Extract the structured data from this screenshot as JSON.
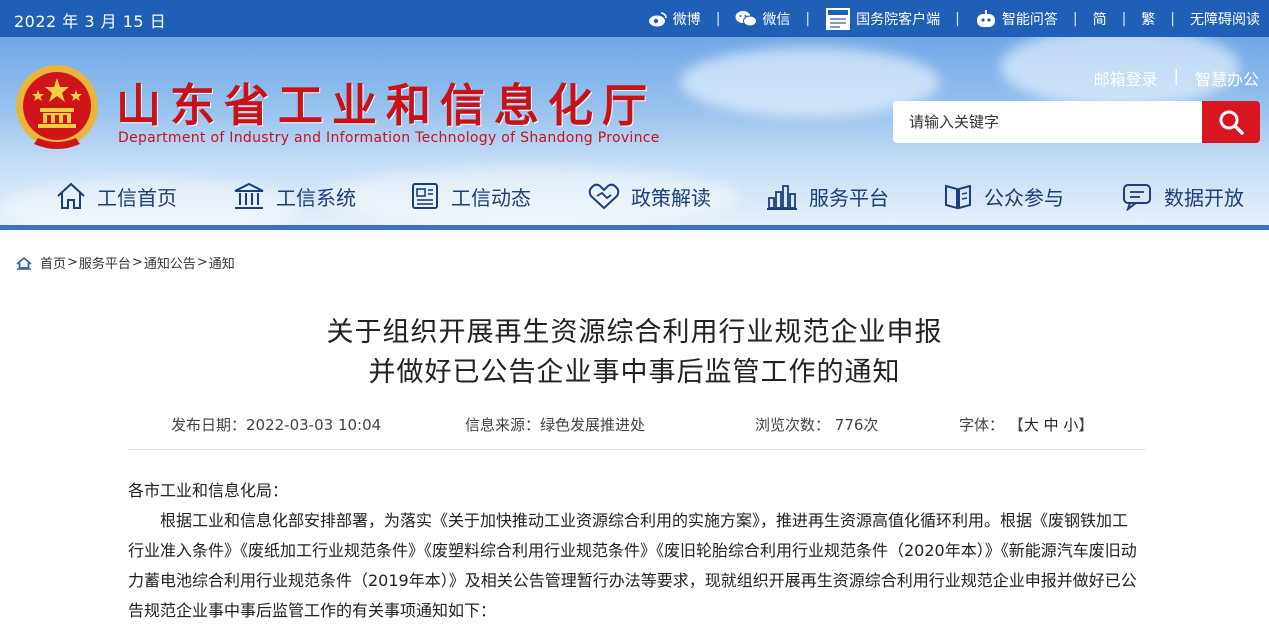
{
  "topbar": {
    "date": "2022 年 3 月 15 日",
    "links": [
      {
        "label": "微博",
        "icon": "weibo-icon"
      },
      {
        "label": "微信",
        "icon": "wechat-icon"
      },
      {
        "label": "国务院客户端",
        "icon": "gov-app-icon"
      },
      {
        "label": "智能问答",
        "icon": "robot-icon"
      },
      {
        "label": "简"
      },
      {
        "label": "繁"
      },
      {
        "label": "无障碍阅读"
      }
    ],
    "separator": "|"
  },
  "header": {
    "title": "山东省工业和信息化厅",
    "subtitle": "Department of Industry and Information Technology of Shandong Province",
    "links": [
      "邮箱登录",
      "智慧办公"
    ],
    "search_placeholder": "请输入关键字"
  },
  "nav": [
    {
      "label": "工信首页",
      "icon": "home-icon"
    },
    {
      "label": "工信系统",
      "icon": "institution-icon"
    },
    {
      "label": "工信动态",
      "icon": "news-icon"
    },
    {
      "label": "政策解读",
      "icon": "handshake-icon"
    },
    {
      "label": "服务平台",
      "icon": "bar-chart-icon"
    },
    {
      "label": "公众参与",
      "icon": "book-icon"
    },
    {
      "label": "数据开放",
      "icon": "chat-icon"
    }
  ],
  "breadcrumb": [
    "首页",
    "服务平台",
    "通知公告",
    "通知"
  ],
  "article": {
    "title_line1": "关于组织开展再生资源综合利用行业规范企业申报",
    "title_line2": "并做好已公告企业事中事后监管工作的通知",
    "meta": {
      "date": "发布日期：2022-03-03 10:04",
      "source": "信息来源：绿色发展推进处",
      "views_label": "浏览次数：",
      "views": "776次",
      "font_label": "字体：",
      "font_open": "【",
      "font_large": "大",
      "font_mid": "中",
      "font_small": "小",
      "font_close": "】"
    },
    "salutation": "各市工业和信息化局：",
    "paragraph": "根据工业和信息化部安排部署，为落实《关于加快推动工业资源综合利用的实施方案》，推进再生资源高值化循环利用。根据《废钢铁加工行业准入条件》《废纸加工行业规范条件》《废塑料综合利用行业规范条件》《废旧轮胎综合利用行业规范条件（2020年本）》《新能源汽车废旧动力蓄电池综合利用行业规范条件（2019年本）》及相关公告管理暂行办法等要求，现就组织开展再生资源综合利用行业规范企业申报并做好已公告规范企业事中事后监管工作的有关事项通知如下："
  },
  "colors": {
    "topbar": "#1f5fb6",
    "title_red": "#c8121a",
    "nav_text": "#1c3f78",
    "search_button": "#d7161f",
    "nav_rule": "#3f72c2"
  }
}
